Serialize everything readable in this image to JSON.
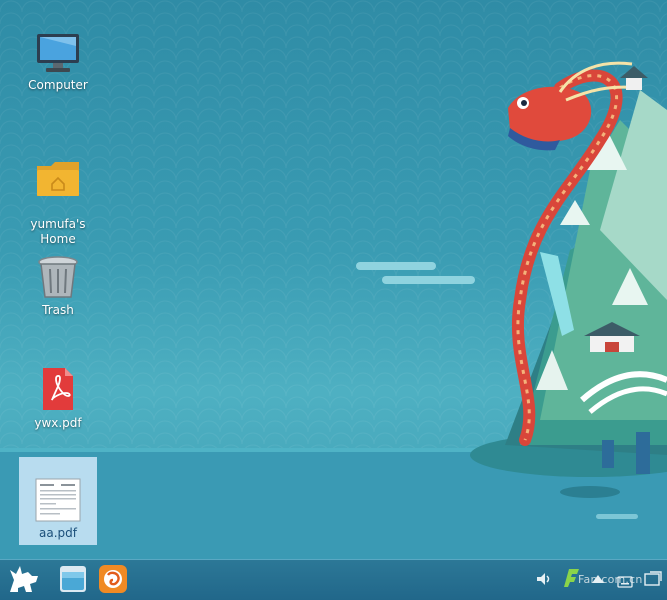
{
  "desktop": {
    "icons": [
      {
        "label": "Computer"
      },
      {
        "label": "yumufa's\nHome"
      },
      {
        "label": "Trash"
      },
      {
        "label": "ywx.pdf"
      },
      {
        "label": "aa.pdf"
      }
    ]
  },
  "taskbar": {
    "watermark": "Fan.com.cn"
  },
  "colors": {
    "taskbar": "#21678a",
    "selection": "#dceeff",
    "folder": "#f2b531",
    "pdf_red": "#e23b3b"
  }
}
